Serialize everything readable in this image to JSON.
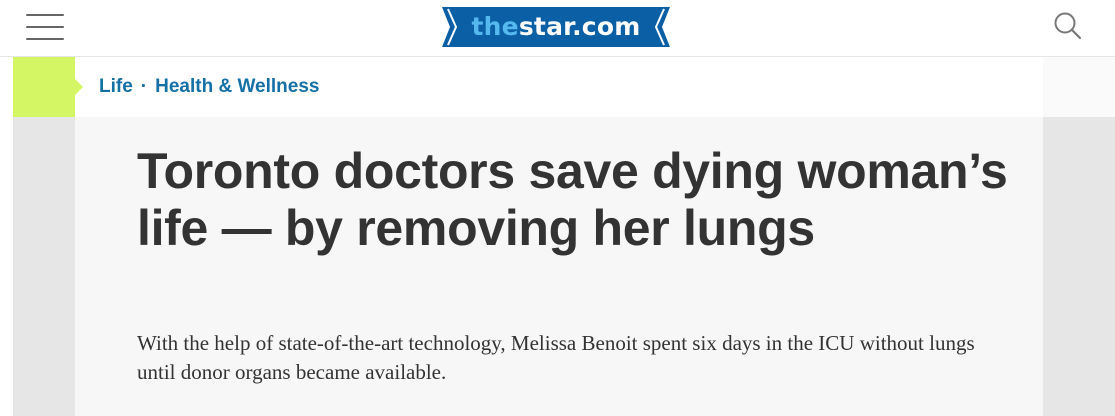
{
  "header": {
    "logo": {
      "the": "the",
      "rest": "star.com",
      "colors": {
        "background": "#0b5fa5",
        "the": "#55b9ef",
        "text": "#ffffff"
      }
    },
    "menu_icon": "hamburger-menu-icon",
    "search_icon": "magnifier-search-icon"
  },
  "section": {
    "accent_color": "#d4f564",
    "crumbs": [
      {
        "label": "Life"
      },
      {
        "label": "Health & Wellness"
      }
    ],
    "separator": "·"
  },
  "article": {
    "headline": "Toronto doctors save dying woman’s life — by removing her lungs",
    "dek": "With the help of state-of-the-art technology, Melissa Benoit spent six days in the ICU without lungs until donor organs became available."
  }
}
